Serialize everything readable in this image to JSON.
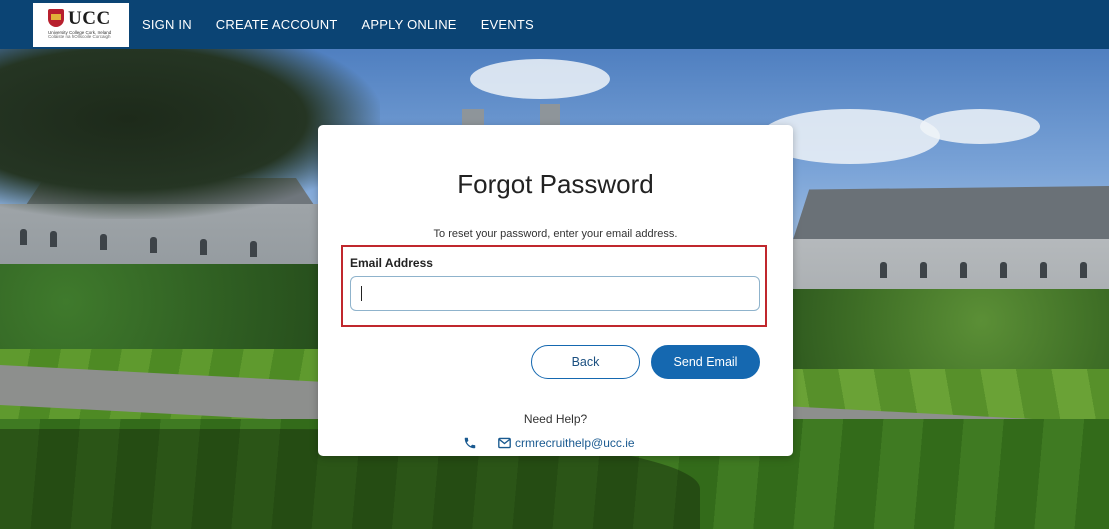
{
  "header": {
    "logo": {
      "text": "UCC",
      "subtitle": "University College Cork, Ireland",
      "subtitle2": "Coláiste na hOllscoile Corcaigh"
    },
    "nav": [
      "SIGN IN",
      "CREATE ACCOUNT",
      "APPLY ONLINE",
      "EVENTS"
    ]
  },
  "form": {
    "title": "Forgot Password",
    "instruction": "To reset your password, enter your email address.",
    "email_label": "Email Address",
    "email_value": "",
    "back_label": "Back",
    "send_label": "Send Email"
  },
  "help": {
    "heading": "Need Help?",
    "email": "crmrecruithelp@ucc.ie",
    "icons": [
      "phone-icon",
      "envelope-icon"
    ]
  },
  "colors": {
    "header_bg": "#0b4474",
    "primary": "#1568b0",
    "highlight_border": "#c0272d"
  }
}
